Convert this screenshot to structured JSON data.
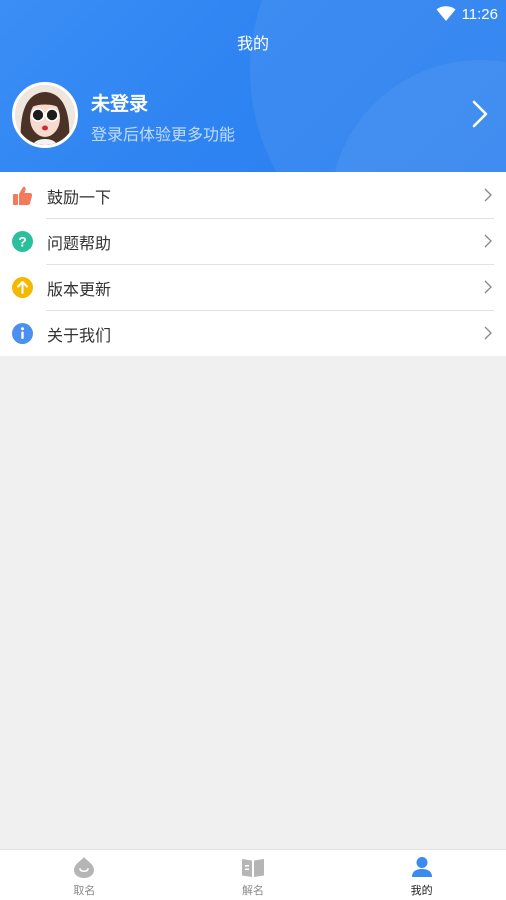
{
  "status": {
    "time": "11:26"
  },
  "header": {
    "title": "我的",
    "username": "未登录",
    "login_hint": "登录后体验更多功能"
  },
  "menu": {
    "items": [
      {
        "label": "鼓励一下",
        "icon": "thumbs-up-icon",
        "color": "#f47a5c"
      },
      {
        "label": "问题帮助",
        "icon": "question-icon",
        "color": "#2bbf9d"
      },
      {
        "label": "版本更新",
        "icon": "upload-arrow-icon",
        "color": "#f5b800"
      },
      {
        "label": "关于我们",
        "icon": "info-icon",
        "color": "#4a90f0"
      }
    ]
  },
  "tabbar": {
    "tabs": [
      {
        "label": "取名",
        "icon": "naming-icon",
        "active": false
      },
      {
        "label": "解名",
        "icon": "book-icon",
        "active": false
      },
      {
        "label": "我的",
        "icon": "user-icon",
        "active": true
      }
    ]
  },
  "colors": {
    "header_blue": "#2f84f2",
    "active_tab": "#3a8af0",
    "inactive_tab": "#b5b5b5"
  }
}
